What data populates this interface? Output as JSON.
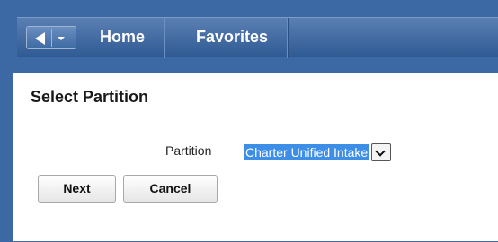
{
  "nav": {
    "home_label": "Home",
    "favorites_label": "Favorites"
  },
  "page": {
    "title": "Select Partition"
  },
  "form": {
    "partition_label": "Partition",
    "partition_value": "Charter Unified Intake"
  },
  "buttons": {
    "next_label": "Next",
    "cancel_label": "Cancel"
  },
  "colors": {
    "nav_bar": "#3c68a3",
    "selection_highlight": "#3d8ee6"
  }
}
